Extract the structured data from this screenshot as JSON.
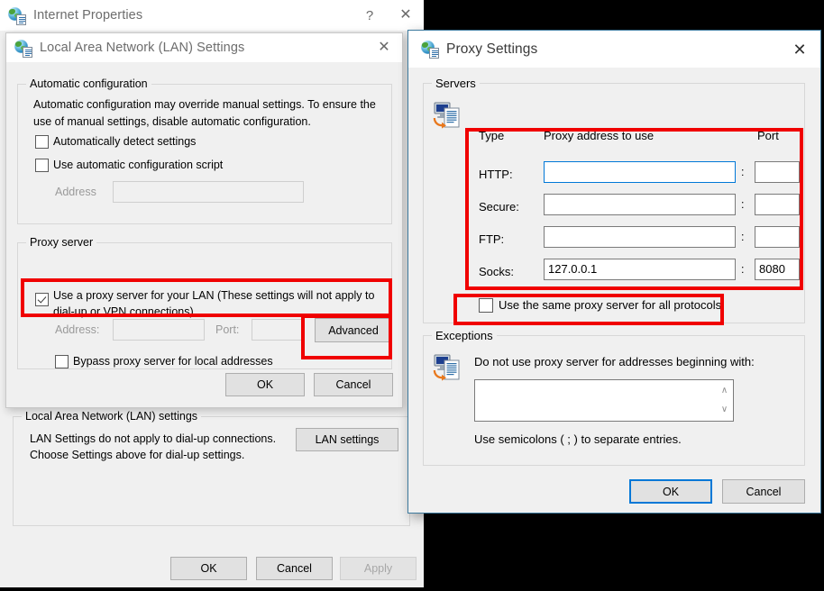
{
  "colors": {
    "accent": "#0078d7",
    "highlight": "#f00000",
    "window_bg": "#f0f0f0",
    "desktop_bg": "#000000"
  },
  "internet_properties": {
    "title": "Internet Properties",
    "icon": "globe-document-icon",
    "help_button": "?",
    "close_button": "✕",
    "lan_group": {
      "legend": "Local Area Network (LAN) settings",
      "description": "LAN Settings do not apply to dial-up connections. Choose Settings above for dial-up settings.",
      "lan_settings_button": "LAN settings"
    },
    "buttons": {
      "ok": "OK",
      "cancel": "Cancel",
      "apply": "Apply"
    }
  },
  "lan_settings": {
    "title": "Local Area Network (LAN) Settings",
    "icon": "globe-document-icon",
    "close_button": "✕",
    "automatic_configuration": {
      "legend": "Automatic configuration",
      "description": "Automatic configuration may override manual settings.  To ensure the use of manual settings, disable automatic configuration.",
      "auto_detect": {
        "label": "Automatically detect settings",
        "checked": false
      },
      "auto_script": {
        "label": "Use automatic configuration script",
        "checked": false
      },
      "address_label": "Address",
      "address_value": ""
    },
    "proxy_server": {
      "legend": "Proxy server",
      "use_proxy": {
        "label": "Use a proxy server for your LAN (These settings will not apply to dial-up or VPN connections).",
        "checked": true
      },
      "address_label": "Address:",
      "address_value": "",
      "port_label": "Port:",
      "port_value": "",
      "advanced_button": "Advanced",
      "bypass": {
        "label": "Bypass proxy server for local addresses",
        "checked": false
      }
    },
    "buttons": {
      "ok": "OK",
      "cancel": "Cancel"
    }
  },
  "proxy_settings": {
    "title": "Proxy Settings",
    "icon": "globe-document-icon",
    "close_button": "✕",
    "servers": {
      "legend": "Servers",
      "icon": "monitor-document-icon",
      "headers": {
        "type": "Type",
        "address": "Proxy address to use",
        "port": "Port"
      },
      "rows": [
        {
          "type": "HTTP:",
          "address": "",
          "port": "",
          "focused": true
        },
        {
          "type": "Secure:",
          "address": "",
          "port": "",
          "focused": false
        },
        {
          "type": "FTP:",
          "address": "",
          "port": "",
          "focused": false
        },
        {
          "type": "Socks:",
          "address": "127.0.0.1",
          "port": "8080",
          "focused": false
        }
      ],
      "separator": ":",
      "same_proxy": {
        "label": "Use the same proxy server for all protocols",
        "checked": false
      }
    },
    "exceptions": {
      "legend": "Exceptions",
      "icon": "monitor-document-icon",
      "description": "Do not use proxy server for addresses beginning with:",
      "value": "",
      "hint": "Use semicolons ( ; ) to separate entries.",
      "scroll_up": "∧",
      "scroll_down": "∨"
    },
    "buttons": {
      "ok": "OK",
      "cancel": "Cancel"
    }
  }
}
